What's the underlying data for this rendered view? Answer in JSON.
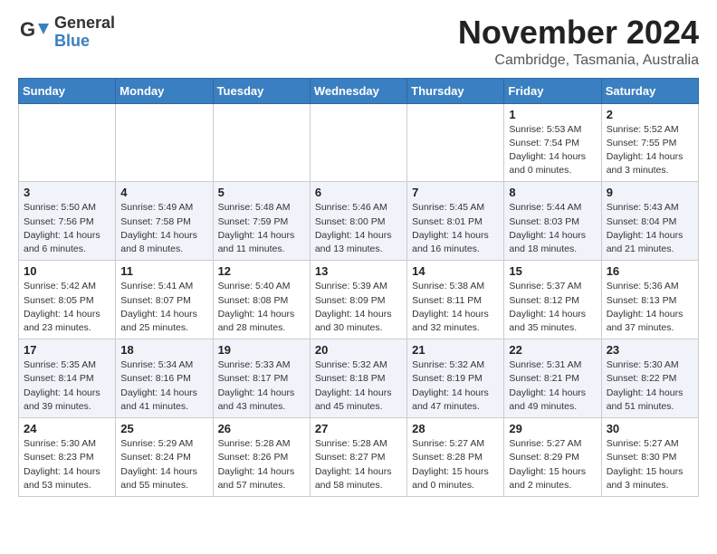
{
  "header": {
    "logo_general": "General",
    "logo_blue": "Blue",
    "month_title": "November 2024",
    "location": "Cambridge, Tasmania, Australia"
  },
  "weekdays": [
    "Sunday",
    "Monday",
    "Tuesday",
    "Wednesday",
    "Thursday",
    "Friday",
    "Saturday"
  ],
  "weeks": [
    [
      {
        "day": "",
        "info": ""
      },
      {
        "day": "",
        "info": ""
      },
      {
        "day": "",
        "info": ""
      },
      {
        "day": "",
        "info": ""
      },
      {
        "day": "",
        "info": ""
      },
      {
        "day": "1",
        "info": "Sunrise: 5:53 AM\nSunset: 7:54 PM\nDaylight: 14 hours\nand 0 minutes."
      },
      {
        "day": "2",
        "info": "Sunrise: 5:52 AM\nSunset: 7:55 PM\nDaylight: 14 hours\nand 3 minutes."
      }
    ],
    [
      {
        "day": "3",
        "info": "Sunrise: 5:50 AM\nSunset: 7:56 PM\nDaylight: 14 hours\nand 6 minutes."
      },
      {
        "day": "4",
        "info": "Sunrise: 5:49 AM\nSunset: 7:58 PM\nDaylight: 14 hours\nand 8 minutes."
      },
      {
        "day": "5",
        "info": "Sunrise: 5:48 AM\nSunset: 7:59 PM\nDaylight: 14 hours\nand 11 minutes."
      },
      {
        "day": "6",
        "info": "Sunrise: 5:46 AM\nSunset: 8:00 PM\nDaylight: 14 hours\nand 13 minutes."
      },
      {
        "day": "7",
        "info": "Sunrise: 5:45 AM\nSunset: 8:01 PM\nDaylight: 14 hours\nand 16 minutes."
      },
      {
        "day": "8",
        "info": "Sunrise: 5:44 AM\nSunset: 8:03 PM\nDaylight: 14 hours\nand 18 minutes."
      },
      {
        "day": "9",
        "info": "Sunrise: 5:43 AM\nSunset: 8:04 PM\nDaylight: 14 hours\nand 21 minutes."
      }
    ],
    [
      {
        "day": "10",
        "info": "Sunrise: 5:42 AM\nSunset: 8:05 PM\nDaylight: 14 hours\nand 23 minutes."
      },
      {
        "day": "11",
        "info": "Sunrise: 5:41 AM\nSunset: 8:07 PM\nDaylight: 14 hours\nand 25 minutes."
      },
      {
        "day": "12",
        "info": "Sunrise: 5:40 AM\nSunset: 8:08 PM\nDaylight: 14 hours\nand 28 minutes."
      },
      {
        "day": "13",
        "info": "Sunrise: 5:39 AM\nSunset: 8:09 PM\nDaylight: 14 hours\nand 30 minutes."
      },
      {
        "day": "14",
        "info": "Sunrise: 5:38 AM\nSunset: 8:11 PM\nDaylight: 14 hours\nand 32 minutes."
      },
      {
        "day": "15",
        "info": "Sunrise: 5:37 AM\nSunset: 8:12 PM\nDaylight: 14 hours\nand 35 minutes."
      },
      {
        "day": "16",
        "info": "Sunrise: 5:36 AM\nSunset: 8:13 PM\nDaylight: 14 hours\nand 37 minutes."
      }
    ],
    [
      {
        "day": "17",
        "info": "Sunrise: 5:35 AM\nSunset: 8:14 PM\nDaylight: 14 hours\nand 39 minutes."
      },
      {
        "day": "18",
        "info": "Sunrise: 5:34 AM\nSunset: 8:16 PM\nDaylight: 14 hours\nand 41 minutes."
      },
      {
        "day": "19",
        "info": "Sunrise: 5:33 AM\nSunset: 8:17 PM\nDaylight: 14 hours\nand 43 minutes."
      },
      {
        "day": "20",
        "info": "Sunrise: 5:32 AM\nSunset: 8:18 PM\nDaylight: 14 hours\nand 45 minutes."
      },
      {
        "day": "21",
        "info": "Sunrise: 5:32 AM\nSunset: 8:19 PM\nDaylight: 14 hours\nand 47 minutes."
      },
      {
        "day": "22",
        "info": "Sunrise: 5:31 AM\nSunset: 8:21 PM\nDaylight: 14 hours\nand 49 minutes."
      },
      {
        "day": "23",
        "info": "Sunrise: 5:30 AM\nSunset: 8:22 PM\nDaylight: 14 hours\nand 51 minutes."
      }
    ],
    [
      {
        "day": "24",
        "info": "Sunrise: 5:30 AM\nSunset: 8:23 PM\nDaylight: 14 hours\nand 53 minutes."
      },
      {
        "day": "25",
        "info": "Sunrise: 5:29 AM\nSunset: 8:24 PM\nDaylight: 14 hours\nand 55 minutes."
      },
      {
        "day": "26",
        "info": "Sunrise: 5:28 AM\nSunset: 8:26 PM\nDaylight: 14 hours\nand 57 minutes."
      },
      {
        "day": "27",
        "info": "Sunrise: 5:28 AM\nSunset: 8:27 PM\nDaylight: 14 hours\nand 58 minutes."
      },
      {
        "day": "28",
        "info": "Sunrise: 5:27 AM\nSunset: 8:28 PM\nDaylight: 15 hours\nand 0 minutes."
      },
      {
        "day": "29",
        "info": "Sunrise: 5:27 AM\nSunset: 8:29 PM\nDaylight: 15 hours\nand 2 minutes."
      },
      {
        "day": "30",
        "info": "Sunrise: 5:27 AM\nSunset: 8:30 PM\nDaylight: 15 hours\nand 3 minutes."
      }
    ]
  ]
}
